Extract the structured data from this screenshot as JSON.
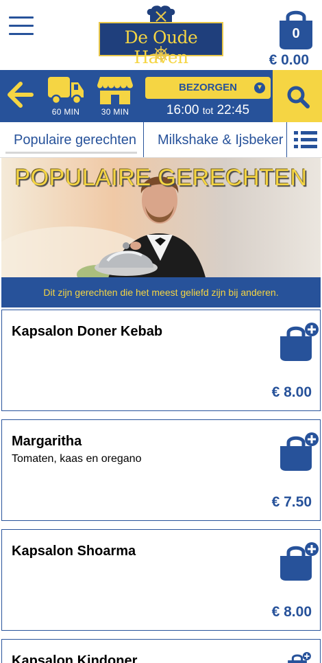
{
  "header": {
    "logo_text": "De Oude Haven",
    "cart_count": "0",
    "cart_total": "€ 0.00"
  },
  "order_bar": {
    "delivery_time": "60 MIN",
    "pickup_time": "30 MIN",
    "mode": "BEZORGEN",
    "hours_from": "16:00",
    "hours_sep": "tot",
    "hours_to": "22:45"
  },
  "tabs": [
    {
      "label": "Populaire gerechten"
    },
    {
      "label": "Milkshake & Ijsbeker B"
    }
  ],
  "banner": {
    "title": "POPULAIRE GERECHTEN",
    "subtitle": "Dit zijn gerechten die het meest geliefd zijn bij anderen."
  },
  "products": [
    {
      "name": "Kapsalon Doner Kebab",
      "description": "",
      "price": "€ 8.00"
    },
    {
      "name": "Margaritha",
      "description": "Tomaten, kaas en oregano",
      "price": "€ 7.50"
    },
    {
      "name": "Kapsalon Shoarma",
      "description": "",
      "price": "€ 8.00"
    },
    {
      "name": "Kapsalon Kindoner",
      "description": "",
      "price": ""
    }
  ],
  "colors": {
    "brand_blue": "#27529a",
    "accent_yellow": "#f5d543"
  }
}
